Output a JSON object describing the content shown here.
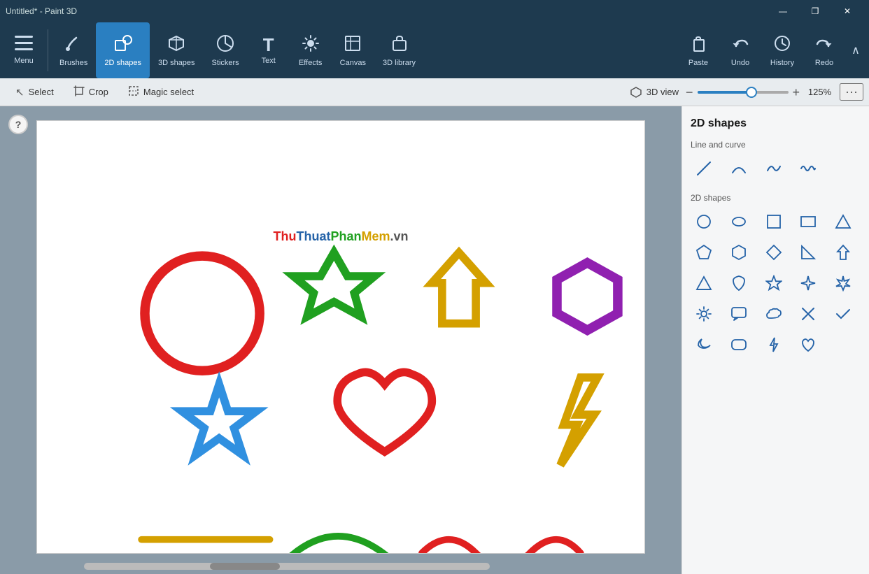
{
  "titleBar": {
    "title": "Untitled* - Paint 3D",
    "controls": [
      "—",
      "❐",
      "✕"
    ]
  },
  "toolbar": {
    "items": [
      {
        "id": "menu",
        "label": "Menu",
        "icon": "☰"
      },
      {
        "id": "brushes",
        "label": "Brushes",
        "icon": "✏️"
      },
      {
        "id": "2d-shapes",
        "label": "2D shapes",
        "icon": "⬡",
        "active": true
      },
      {
        "id": "3d-shapes",
        "label": "3D shapes",
        "icon": "🧊"
      },
      {
        "id": "stickers",
        "label": "Stickers",
        "icon": "⭐"
      },
      {
        "id": "text",
        "label": "Text",
        "icon": "T"
      },
      {
        "id": "effects",
        "label": "Effects",
        "icon": "✨"
      },
      {
        "id": "canvas",
        "label": "Canvas",
        "icon": "⊞"
      },
      {
        "id": "3d-library",
        "label": "3D library",
        "icon": "📦"
      }
    ],
    "right": [
      {
        "id": "paste",
        "label": "Paste",
        "icon": "📋"
      },
      {
        "id": "undo",
        "label": "Undo",
        "icon": "↩"
      },
      {
        "id": "history",
        "label": "History",
        "icon": "🕐"
      },
      {
        "id": "redo",
        "label": "Redo",
        "icon": "↪"
      }
    ]
  },
  "subToolbar": {
    "items": [
      {
        "id": "select",
        "label": "Select",
        "icon": "↖"
      },
      {
        "id": "crop",
        "label": "Crop",
        "icon": "⊡"
      },
      {
        "id": "magic-select",
        "label": "Magic select",
        "icon": "⊟"
      }
    ],
    "view3d": "3D view",
    "zoomLevel": "125%"
  },
  "rightPanel": {
    "title": "2D shapes",
    "sections": [
      {
        "label": "Line and curve",
        "shapes": [
          "line",
          "arc",
          "curve",
          "wave"
        ]
      },
      {
        "label": "2D shapes",
        "shapes": [
          "circle",
          "oval",
          "square",
          "rectangle",
          "triangle",
          "pentagon",
          "hexagon",
          "diamond",
          "right-triangle",
          "up-arrow",
          "triangle2",
          "leaf",
          "star5",
          "star4",
          "star6",
          "sun",
          "speech-bubble",
          "cloud",
          "x-mark",
          "check",
          "moon",
          "rounded-rect",
          "lightning",
          "heart"
        ]
      }
    ]
  },
  "watermark": {
    "text": "ThuThuatPhanMem.vn"
  },
  "canvas": {
    "shapes": [
      {
        "type": "circle",
        "color": "#e02020"
      },
      {
        "type": "star6",
        "color": "#20a020"
      },
      {
        "type": "arrow-up",
        "color": "#d4a000"
      },
      {
        "type": "hexagon",
        "color": "#9020b0"
      },
      {
        "type": "star5",
        "color": "#3090e0"
      },
      {
        "type": "heart",
        "color": "#e02020"
      },
      {
        "type": "lightning",
        "color": "#d4a000"
      },
      {
        "type": "line",
        "color": "#d4a000"
      },
      {
        "type": "arc",
        "color": "#20a020"
      },
      {
        "type": "wave",
        "color": "#e02020"
      }
    ]
  }
}
